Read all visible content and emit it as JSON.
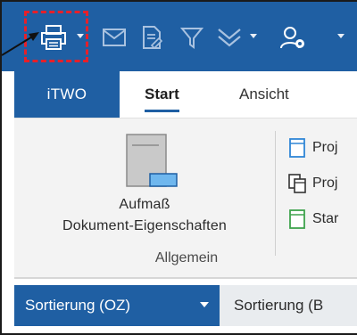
{
  "toolbar": {
    "items": [
      {
        "icon": "printer-icon"
      },
      {
        "icon": "mail-icon"
      },
      {
        "icon": "document-edit-icon"
      },
      {
        "icon": "filter-icon"
      },
      {
        "icon": "double-chevron-down-icon"
      },
      {
        "icon": "user-settings-icon"
      }
    ],
    "background": "#1f5fa3",
    "highlight_color": "#e6202a"
  },
  "tabs": {
    "itwo_label": "iTWO",
    "start_label": "Start",
    "ansicht_label": "Ansicht"
  },
  "ribbon": {
    "big_button": {
      "line1": "Aufmaß",
      "line2": "Dokument-Eigenschaften",
      "icon": "document-properties-icon"
    },
    "small_buttons": [
      {
        "label": "Proj",
        "icon": "project-icon"
      },
      {
        "label": "Proj",
        "icon": "project-copy-icon"
      },
      {
        "label": "Star",
        "icon": "start-icon"
      }
    ],
    "group_label": "Allgemein"
  },
  "sortbar": {
    "active_label": "Sortierung (OZ)",
    "second_label": "Sortierung (B"
  },
  "colors": {
    "accent": "#1f5fa3",
    "tab_accent": "#1f5fa3",
    "green_icon": "#3fa34d"
  }
}
